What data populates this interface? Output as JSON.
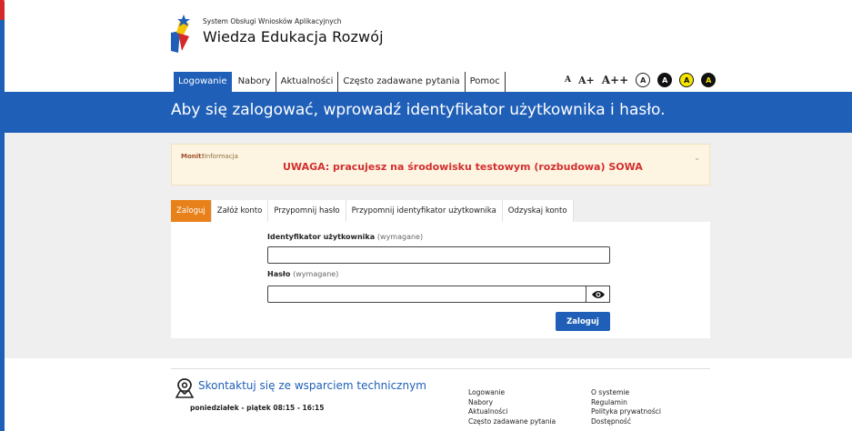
{
  "header": {
    "system_title": "System Obsługi Wniosków Aplikacyjnych",
    "brand": "Wiedza Edukacja Rozwój",
    "nav": [
      "Logowanie",
      "Nabory",
      "Aktualności",
      "Często zadawane pytania",
      "Pomoc"
    ],
    "font_size_controls": [
      "A",
      "A+",
      "A++"
    ],
    "contrast_controls": [
      "A",
      "A",
      "A",
      "A"
    ]
  },
  "banner": {
    "title": "Aby się zalogować, wprowadź identyfikator użytkownika i hasło."
  },
  "notice": {
    "monit_label": "Monit!",
    "info_label": "Informacja",
    "warning": "UWAGA: pracujesz na środowisku testowym (rozbudowa) SOWA"
  },
  "tabs": [
    "Zaloguj",
    "Załóż konto",
    "Przypomnij hasło",
    "Przypomnij identyfikator użytkownika",
    "Odzyskaj konto"
  ],
  "form": {
    "username_label": "Identyfikator użytkownika",
    "password_label": "Hasło",
    "required": "(wymagane)",
    "username_value": "",
    "password_value": "",
    "submit_label": "Zaloguj"
  },
  "footer": {
    "support_title": "Skontaktuj się ze wsparciem technicznym",
    "hours": "poniedziałek - piątek 08:15 - 16:15",
    "links_col1": [
      "Logowanie",
      "Nabory",
      "Aktualności",
      "Często zadawane pytania"
    ],
    "links_col2": [
      "O systemie",
      "Regulamin",
      "Polityka prywatności",
      "Dostępność"
    ]
  },
  "colors": {
    "primary_blue": "#1f5fb8",
    "tab_orange": "#e8811a",
    "warning_red": "#d32f2f",
    "notice_bg": "#fdf5e2"
  }
}
